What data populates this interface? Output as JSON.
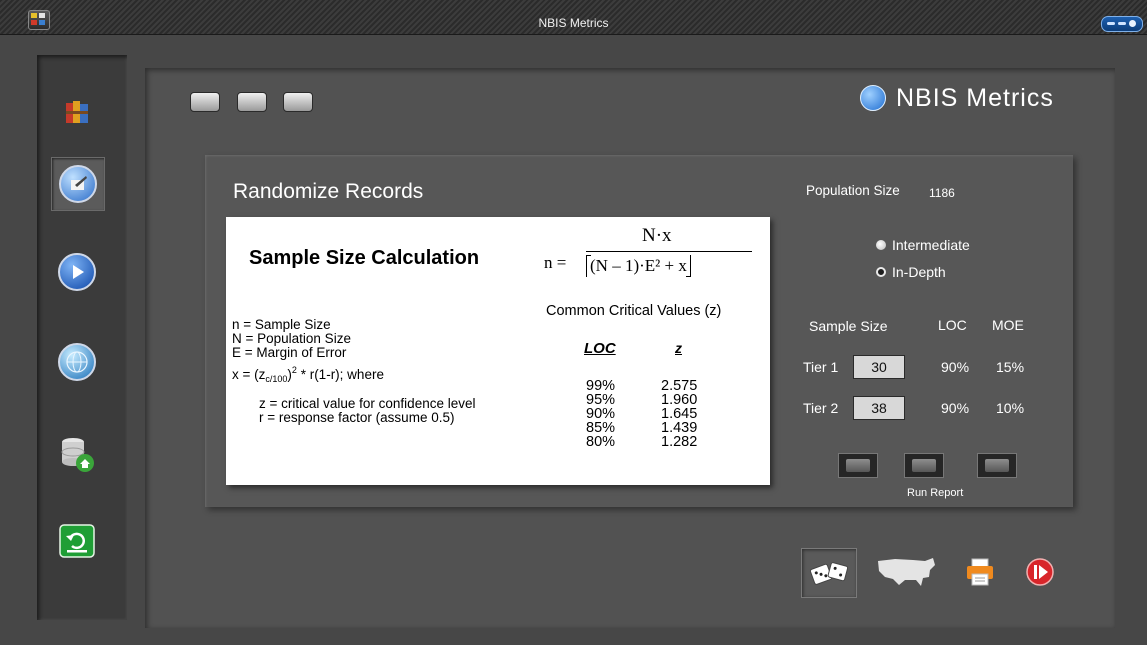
{
  "window": {
    "title": "NBIS Metrics"
  },
  "brand": {
    "name": "NBIS Metrics"
  },
  "section": {
    "title": "Randomize Records"
  },
  "card": {
    "heading": "Sample Size Calculation",
    "formula": {
      "lhs": "n =",
      "numerator": "N·x",
      "denominator": "(N – 1)·E² + x"
    },
    "definitions": {
      "n": "n = Sample Size",
      "N": "N = Population Size",
      "E": "E = Margin of Error",
      "x_prefix": "x = (z",
      "x_sub": "c/100",
      "x_close": ")",
      "x_sup": "2",
      "x_suffix": " * r(1-r); where",
      "z": "z = critical value for confidence level",
      "r": "r = response factor (assume 0.5)"
    },
    "critical_values": {
      "title": "Common Critical Values (z)",
      "loc_header": "LOC",
      "z_header": "z",
      "rows": [
        {
          "loc": "99%",
          "z": "2.575"
        },
        {
          "loc": "95%",
          "z": "1.960"
        },
        {
          "loc": "90%",
          "z": "1.645"
        },
        {
          "loc": "85%",
          "z": "1.439"
        },
        {
          "loc": "80%",
          "z": "1.282"
        }
      ]
    }
  },
  "controls": {
    "population_label": "Population Size",
    "population_value": "1186",
    "radio_intermediate": "Intermediate",
    "radio_indepth": "In-Depth",
    "sample_size_header": "Sample Size",
    "loc_header": "LOC",
    "moe_header": "MOE",
    "tiers": [
      {
        "label": "Tier 1",
        "sample": "30",
        "loc": "90%",
        "moe": "15%"
      },
      {
        "label": "Tier 2",
        "sample": "38",
        "loc": "90%",
        "moe": "10%"
      }
    ],
    "run_report_label": "Run Report"
  },
  "colors": {
    "background": "#474747",
    "panel": "#525252",
    "card": "#ffffff",
    "accent_blue": "#1e6dd1",
    "exit_red": "#d8252a"
  }
}
